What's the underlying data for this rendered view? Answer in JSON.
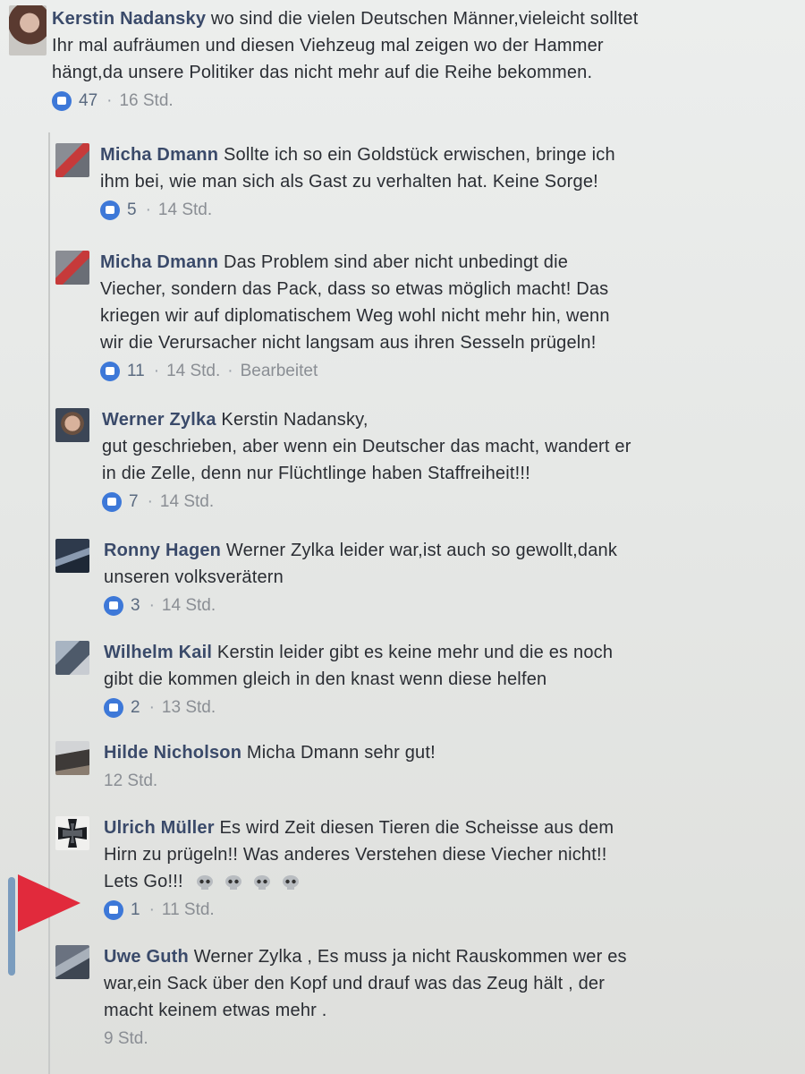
{
  "main_comment": {
    "author": "Kerstin Nadansky",
    "text_lines": [
      "wo sind die vielen Deutschen Männer,vieleicht solltet",
      "Ihr mal aufräumen und diesen Viehzeug mal zeigen wo der Hammer",
      "hängt,da unsere Politiker das nicht mehr auf die Reihe bekommen."
    ],
    "likes": "47",
    "time": "16 Std."
  },
  "replies": [
    {
      "author": "Micha Dmann",
      "lines": [
        "Sollte ich so ein Goldstück erwischen, bringe ich",
        "ihm bei, wie man sich als Gast zu verhalten hat. Keine Sorge!"
      ],
      "likes": "5",
      "time": "14 Std.",
      "edited": ""
    },
    {
      "author": "Micha Dmann",
      "lines": [
        "Das Problem sind aber nicht unbedingt die",
        "Viecher, sondern das Pack, dass so etwas möglich macht! Das",
        "kriegen wir auf diplomatischem Weg wohl nicht mehr hin, wenn",
        "wir die Verursacher nicht langsam aus ihren Sesseln prügeln!"
      ],
      "likes": "11",
      "time": "14 Std.",
      "edited": "Bearbeitet"
    },
    {
      "author": "Werner Zylka",
      "lines": [
        "Kerstin Nadansky,",
        "gut geschrieben, aber wenn ein Deutscher das macht, wandert er",
        "in die Zelle, denn nur Flüchtlinge haben Staffreiheit!!!"
      ],
      "likes": "7",
      "time": "14 Std.",
      "edited": ""
    },
    {
      "author": "Ronny Hagen",
      "lines": [
        "Werner Zylka leider war,ist auch so gewollt,dank",
        "unseren volksverätern"
      ],
      "likes": "3",
      "time": "14 Std.",
      "edited": ""
    },
    {
      "author": "Wilhelm Kail",
      "lines": [
        "Kerstin leider gibt es keine mehr und die es noch",
        "gibt die kommen gleich in den knast wenn diese helfen"
      ],
      "likes": "2",
      "time": "13 Std.",
      "edited": ""
    },
    {
      "author": "Hilde Nicholson",
      "lines": [
        "Micha Dmann sehr gut!"
      ],
      "likes": "",
      "time": "12 Std.",
      "edited": ""
    },
    {
      "author": "Ulrich Müller",
      "lines": [
        "Es wird Zeit diesen Tieren die Scheisse aus dem",
        "Hirn zu prügeln!! Was anderes Verstehen diese Viecher nicht!!",
        "Lets Go!!!"
      ],
      "likes": "1",
      "time": "11 Std.",
      "edited": ""
    },
    {
      "author": "Uwe Guth",
      "lines": [
        "Werner Zylka , Es muss ja nicht Rauskommen wer es",
        "war,ein Sack über den Kopf und drauf was das Zeug hält , der",
        "macht keinem etwas mehr ."
      ],
      "likes": "",
      "time": "9 Std.",
      "edited": ""
    }
  ],
  "colors": {
    "like_blue": "#3d78d8",
    "author_text": "#3a4a6a",
    "meta_gray": "#8a8e94",
    "marker_red": "#e12a3c"
  }
}
